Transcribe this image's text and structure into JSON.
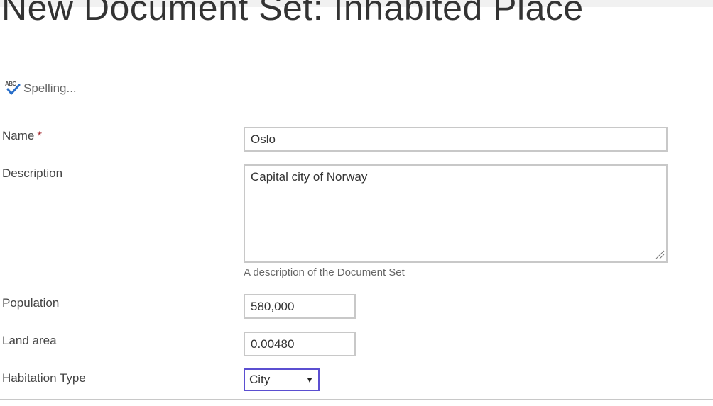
{
  "page": {
    "title": "New Document Set: Inhabited Place"
  },
  "toolbar": {
    "spelling_label": "Spelling...",
    "spelling_icon": "spell-check-icon",
    "spelling_icon_text": "ABC"
  },
  "form": {
    "name": {
      "label": "Name",
      "required_marker": "*",
      "value": "Oslo"
    },
    "description": {
      "label": "Description",
      "value": "Capital city of Norway",
      "hint": "A description of the Document Set"
    },
    "population": {
      "label": "Population",
      "value": "580,000"
    },
    "land_area": {
      "label": "Land area",
      "value": "0.00480"
    },
    "habitation_type": {
      "label": "Habitation Type",
      "selected": "City",
      "arrow": "▼"
    }
  },
  "colors": {
    "required": "#a4262c",
    "focus_border": "#5b4fd1",
    "input_border": "#c8c8c8",
    "check_icon": "#2a6fc9"
  }
}
